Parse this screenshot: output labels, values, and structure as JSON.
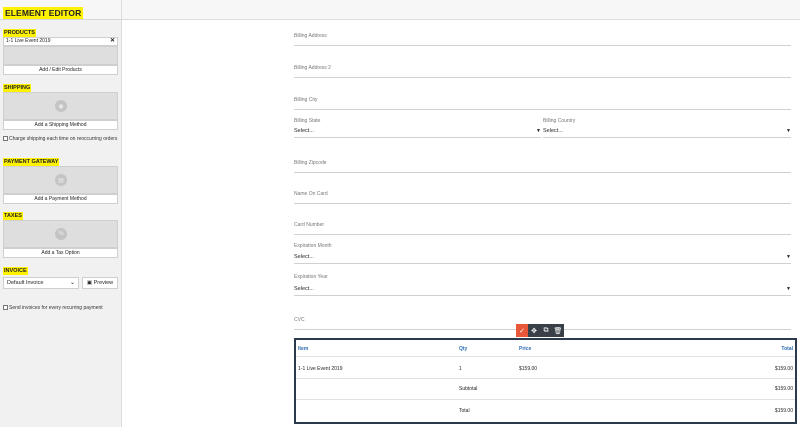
{
  "sidebar": {
    "title": "ELEMENT EDITOR",
    "products": {
      "label": "PRODUCTS",
      "item": "1-1 Live Event 2019",
      "button": "Add / Edit Products"
    },
    "shipping": {
      "label": "SHIPPING",
      "button": "Add a Shipping Method",
      "checkbox": "Charge shipping each time on reoccurring orders"
    },
    "payment": {
      "label": "PAYMENT GATEWAY",
      "button": "Add a Payment Method"
    },
    "taxes": {
      "label": "TAXES",
      "button": "Add a Tax Option"
    },
    "invoice": {
      "label": "INVOICE",
      "selected": "Default Invoice",
      "preview": "Preview",
      "checkbox": "Send invoices for every recurring payment"
    }
  },
  "form": {
    "billing_address": "Billing Address",
    "billing_address_2": "Billing Address 2",
    "billing_city": "Billing City",
    "billing_state": "Billing State",
    "billing_state_value": "Select...",
    "billing_country": "Billing Country",
    "billing_country_value": "Select...",
    "billing_zipcode": "Billing Zipcode",
    "name_on_card": "Name On Card",
    "card_number": "Card Number",
    "expiration_month": "Expiration Month",
    "expiration_month_value": "Select...",
    "expiration_year": "Expiration Year",
    "expiration_year_value": "Select...",
    "cvc": "CVC"
  },
  "table": {
    "headers": {
      "item": "Item",
      "qty": "Qty",
      "price": "Price",
      "total": "Total"
    },
    "row": {
      "item": "1-1 Live Event 2019",
      "qty": "1",
      "price": "$159.00",
      "total": "$159.00"
    },
    "subtotal_label": "Subtotal",
    "subtotal_value": "$159.00",
    "total_label": "Total",
    "total_value": "$159.00"
  },
  "colors": {
    "accent": "#e8573a",
    "highlight": "#fff200",
    "table_border": "#2b3a4c",
    "header_text": "#2b6cb0"
  }
}
